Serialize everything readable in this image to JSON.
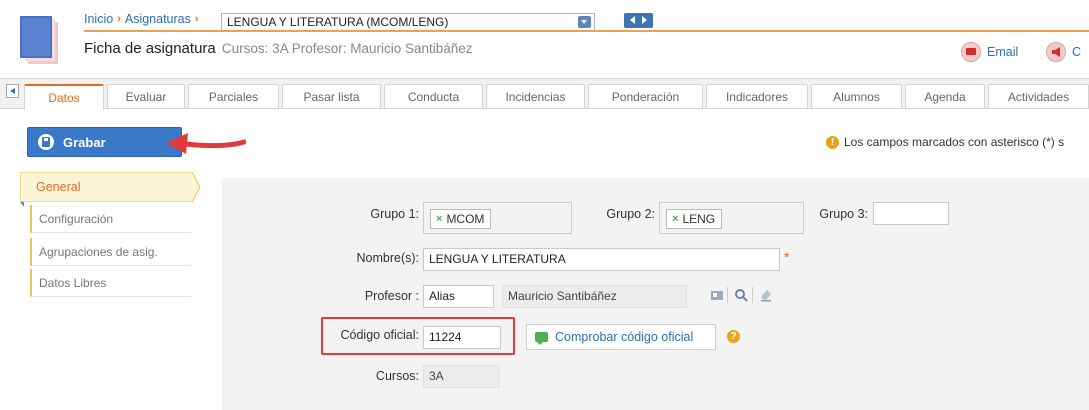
{
  "breadcrumb": {
    "home": "Inicio",
    "section": "Asignaturas",
    "selected": "LENGUA Y LITERATURA (MCOM/LENG)"
  },
  "title": {
    "main": "Ficha de asignatura",
    "sub": "Cursos: 3A Profesor: Mauricio Santibáñez"
  },
  "header_actions": {
    "email": "Email",
    "extra": "C"
  },
  "tabs": [
    {
      "label": "Datos",
      "active": true
    },
    {
      "label": "Evaluar"
    },
    {
      "label": "Parciales"
    },
    {
      "label": "Pasar lista"
    },
    {
      "label": "Conducta"
    },
    {
      "label": "Incidencias"
    },
    {
      "label": "Ponderación"
    },
    {
      "label": "Indicadores"
    },
    {
      "label": "Alumnos"
    },
    {
      "label": "Agenda"
    },
    {
      "label": "Actividades"
    }
  ],
  "toolbar": {
    "save_label": "Grabar",
    "notice": "Los campos marcados con asterisco (*) s"
  },
  "sidebar": {
    "general": "General",
    "items": [
      "Configuración",
      "Agrupaciones de asig.",
      "Datos Libres"
    ]
  },
  "form": {
    "grupo1_label": "Grupo 1:",
    "grupo1_value": "MCOM",
    "grupo2_label": "Grupo 2:",
    "grupo2_value": "LENG",
    "grupo3_label": "Grupo 3:",
    "grupo3_value": "",
    "nombre_label": "Nombre(s):",
    "nombre_value": "LENGUA Y LITERATURA",
    "required_mark": "*",
    "profesor_label": "Profesor :",
    "profesor_alias": "Alias",
    "profesor_name": "Mauricio Santibáñez",
    "codigo_label": "Código oficial:",
    "codigo_value": "11224",
    "check_button": "Comprobar código oficial",
    "help_mark": "?",
    "warn_mark": "!",
    "cursos_label": "Cursos:",
    "cursos_value": "3A",
    "chip_remove": "×"
  },
  "colors": {
    "accent_orange": "#e56a1e",
    "primary_blue": "#3a78c9",
    "link_blue": "#2b6fb6",
    "annotation_red": "#e23a3a"
  }
}
